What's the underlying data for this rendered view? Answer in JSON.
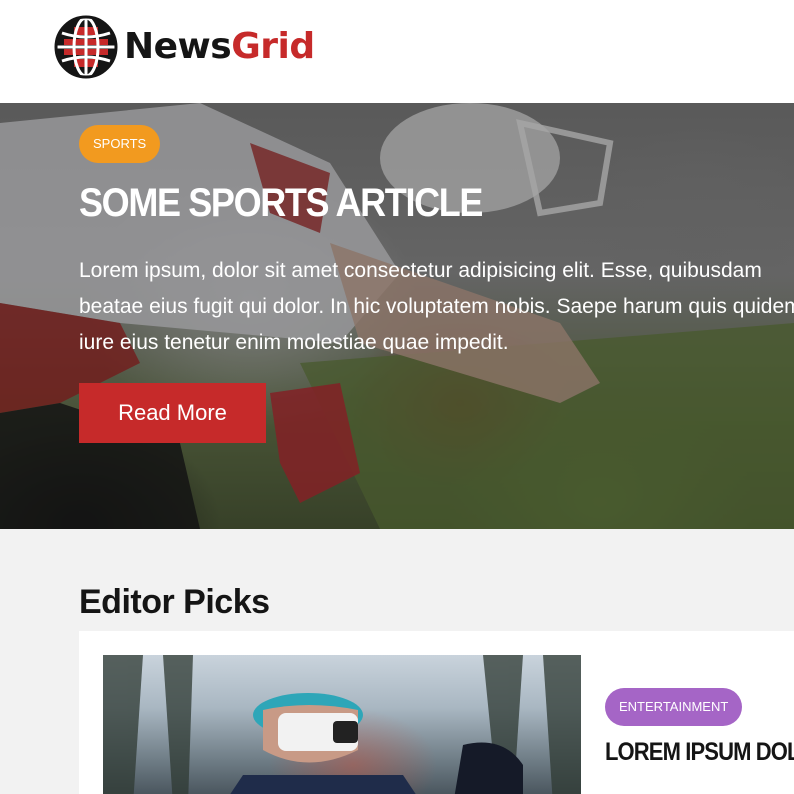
{
  "header": {
    "logo_part1": "News",
    "logo_part2": "Grid"
  },
  "hero": {
    "category": "SPORTS",
    "title": "SOME SPORTS ARTICLE",
    "text": "Lorem ipsum, dolor sit amet consectetur adipisicing elit. Esse, quibusdam beatae eius fugit qui dolor. In hic voluptatem nobis. Saepe harum quis quidem iure eius tenetur enim molestiae quae impedit.",
    "button_label": "Read More"
  },
  "editor_picks": {
    "title": "Editor Picks",
    "items": [
      {
        "category": "ENTERTAINMENT",
        "title": "LOREM IPSUM DOLOR"
      }
    ]
  },
  "colors": {
    "brand_red": "#c62a2a",
    "sports_badge": "#f29a1f",
    "entertainment_badge": "#a565c6"
  },
  "icons": [
    "globe-icon"
  ]
}
